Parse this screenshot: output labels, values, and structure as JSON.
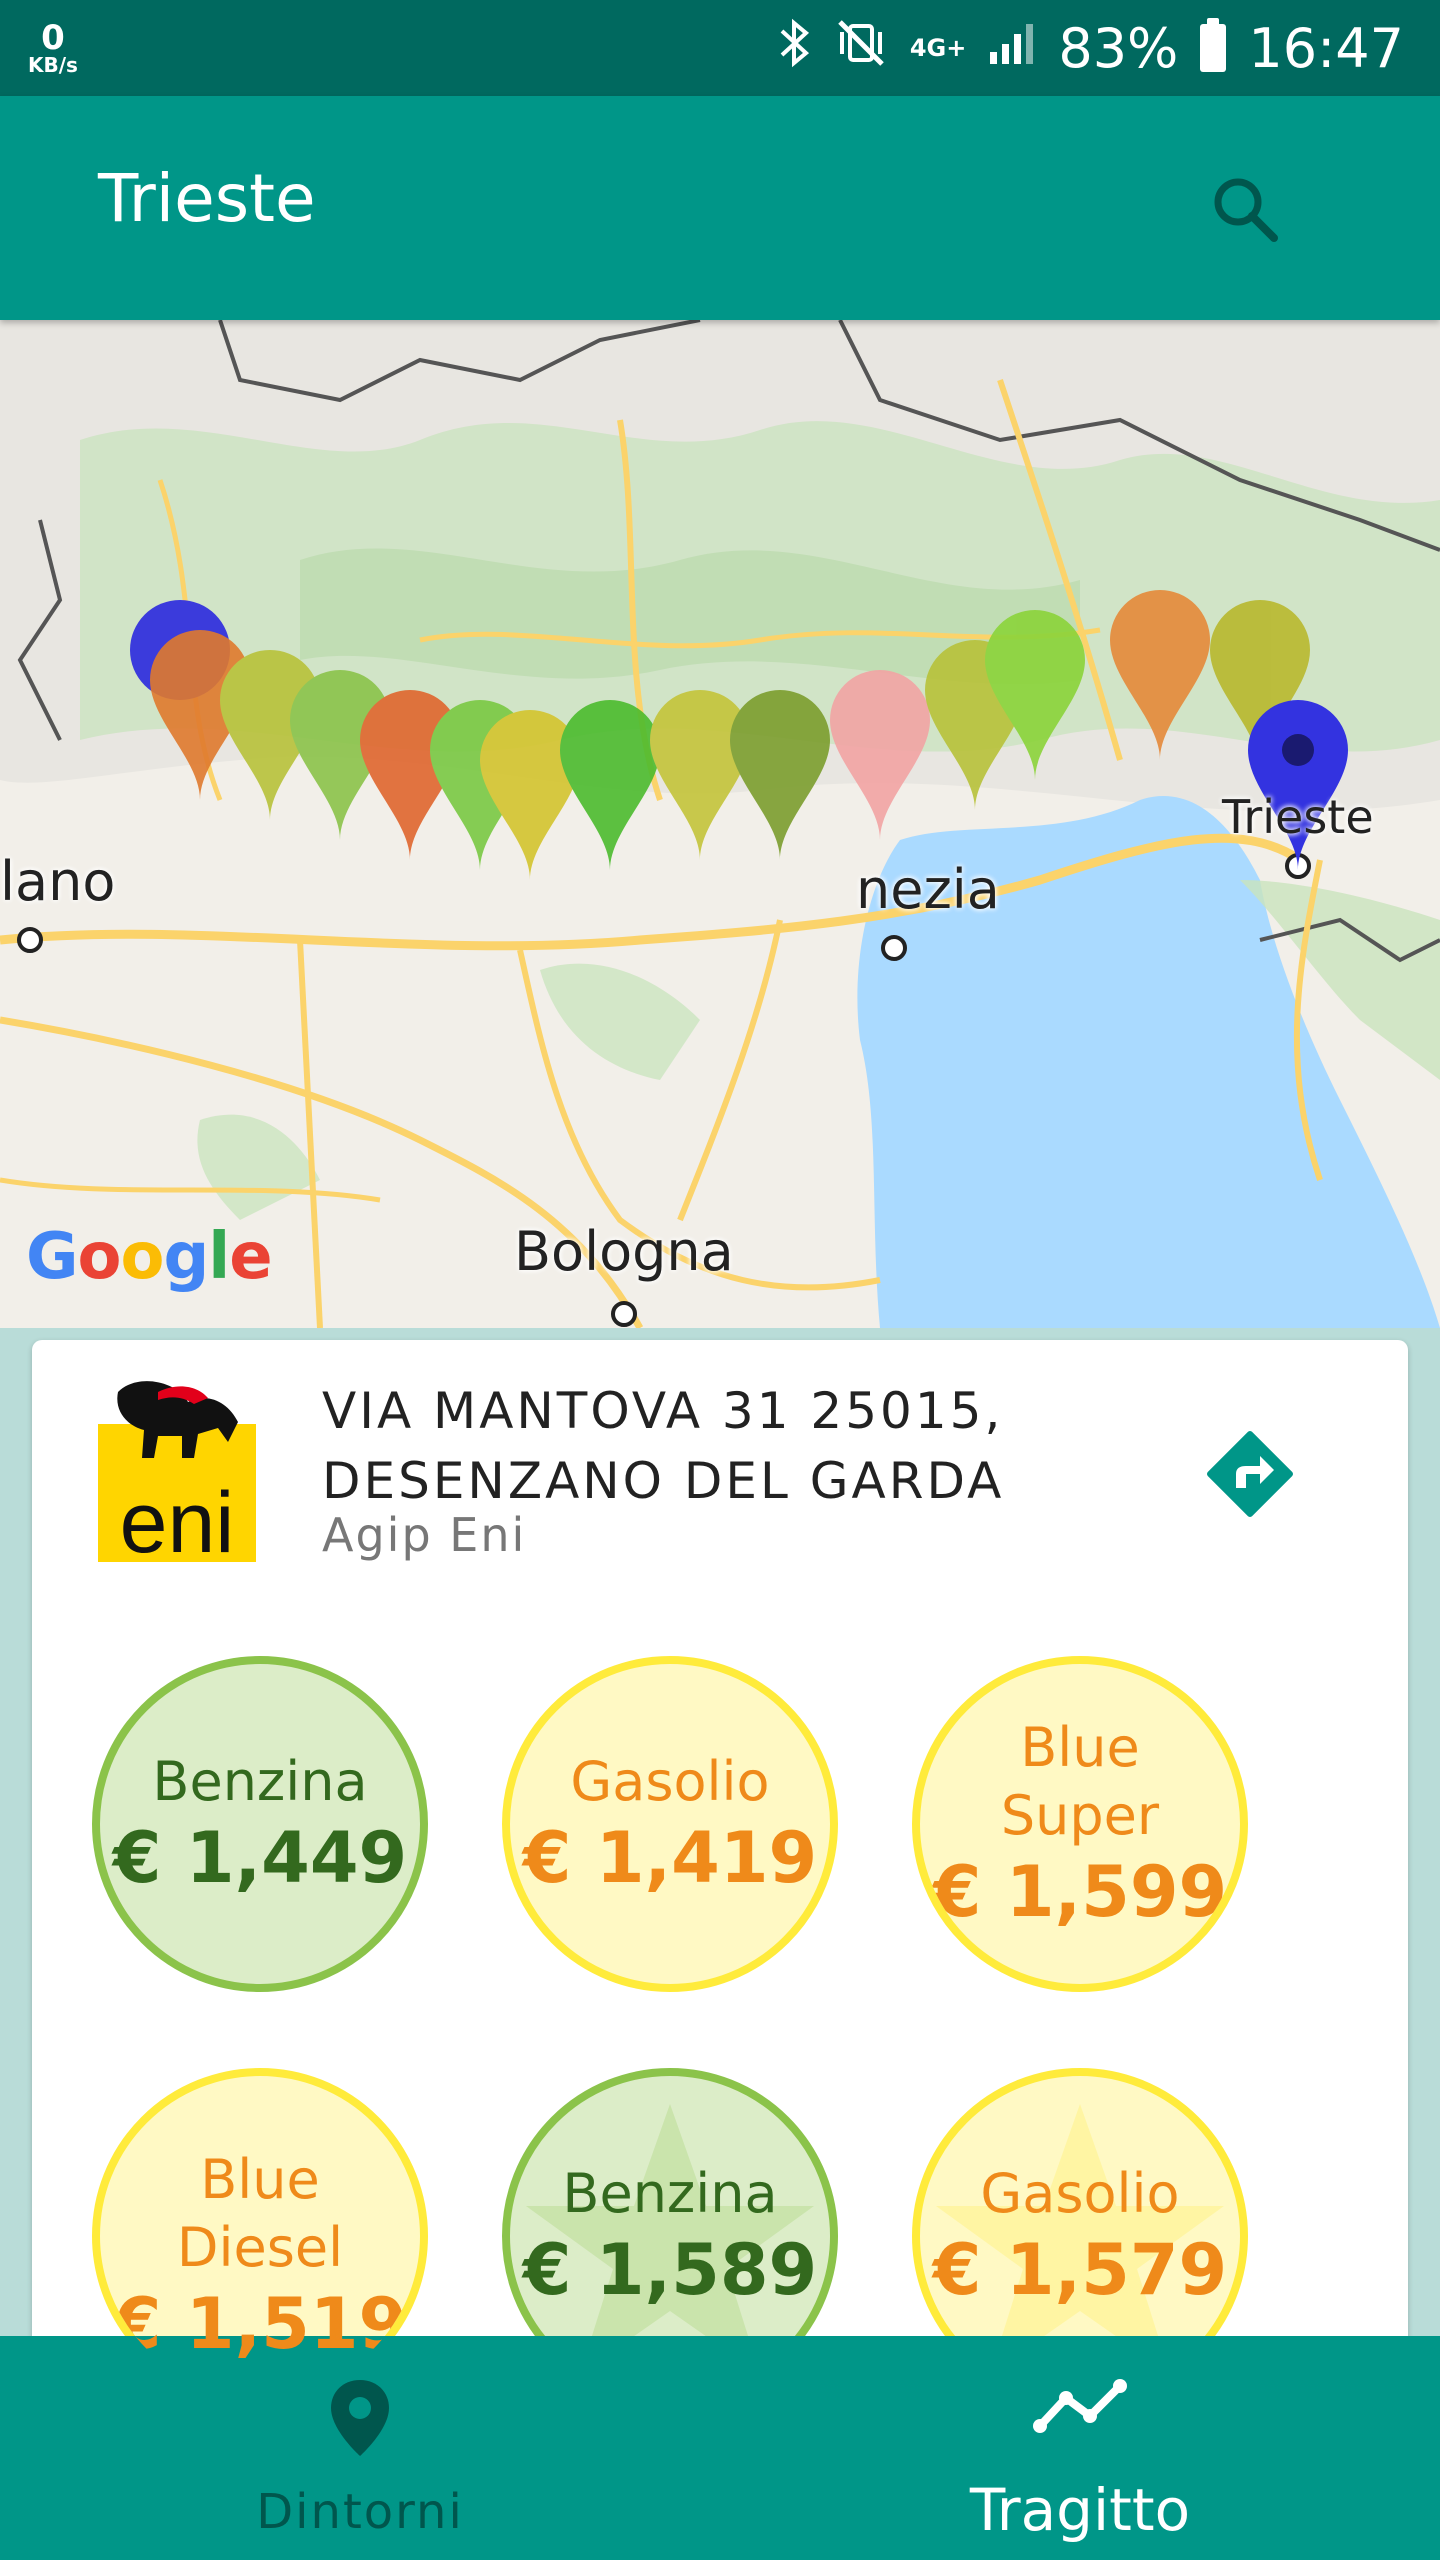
{
  "status_bar": {
    "speed_value": "0",
    "speed_unit": "KB/s",
    "network": "4G+",
    "battery": "83%",
    "time": "16:47"
  },
  "app_bar": {
    "title": "Trieste"
  },
  "map": {
    "labels": {
      "milano": "lano",
      "venezia": "nezia",
      "trieste": "Trieste",
      "bologna": "Bologna"
    },
    "attribution": "Google"
  },
  "station": {
    "address_line1": "VIA MANTOVA 31 25015,",
    "address_line2": "DESENZANO DEL GARDA",
    "brand": "Agip Eni",
    "logo_text": "eni"
  },
  "prices": [
    {
      "label": "Benzina",
      "price": "€ 1,449",
      "color": "green"
    },
    {
      "label": "Gasolio",
      "price": "€ 1,419",
      "color": "yellow"
    },
    {
      "label": "Blue Super",
      "price": "€ 1,599",
      "color": "yellow"
    },
    {
      "label": "Blue Diesel",
      "price": "€ 1,519",
      "color": "yellow"
    },
    {
      "label": "Benzina",
      "price": "€ 1,589",
      "color": "green",
      "starred": true
    },
    {
      "label": "Gasolio",
      "price": "€ 1,579",
      "color": "yellow",
      "starred": true
    }
  ],
  "bottom_nav": {
    "items": [
      {
        "label": "Dintorni",
        "icon": "location-pin-icon",
        "active": false
      },
      {
        "label": "Tragitto",
        "icon": "route-trend-icon",
        "active": true
      }
    ]
  },
  "colors": {
    "primary": "#009688",
    "primary_dark": "#00695f",
    "green_ring": "#8bc34a",
    "yellow_ring": "#ffeb3b",
    "orange_text": "#ef8a1a",
    "dark_green_text": "#33691e",
    "route_pin_start": "#3b3bdc"
  }
}
